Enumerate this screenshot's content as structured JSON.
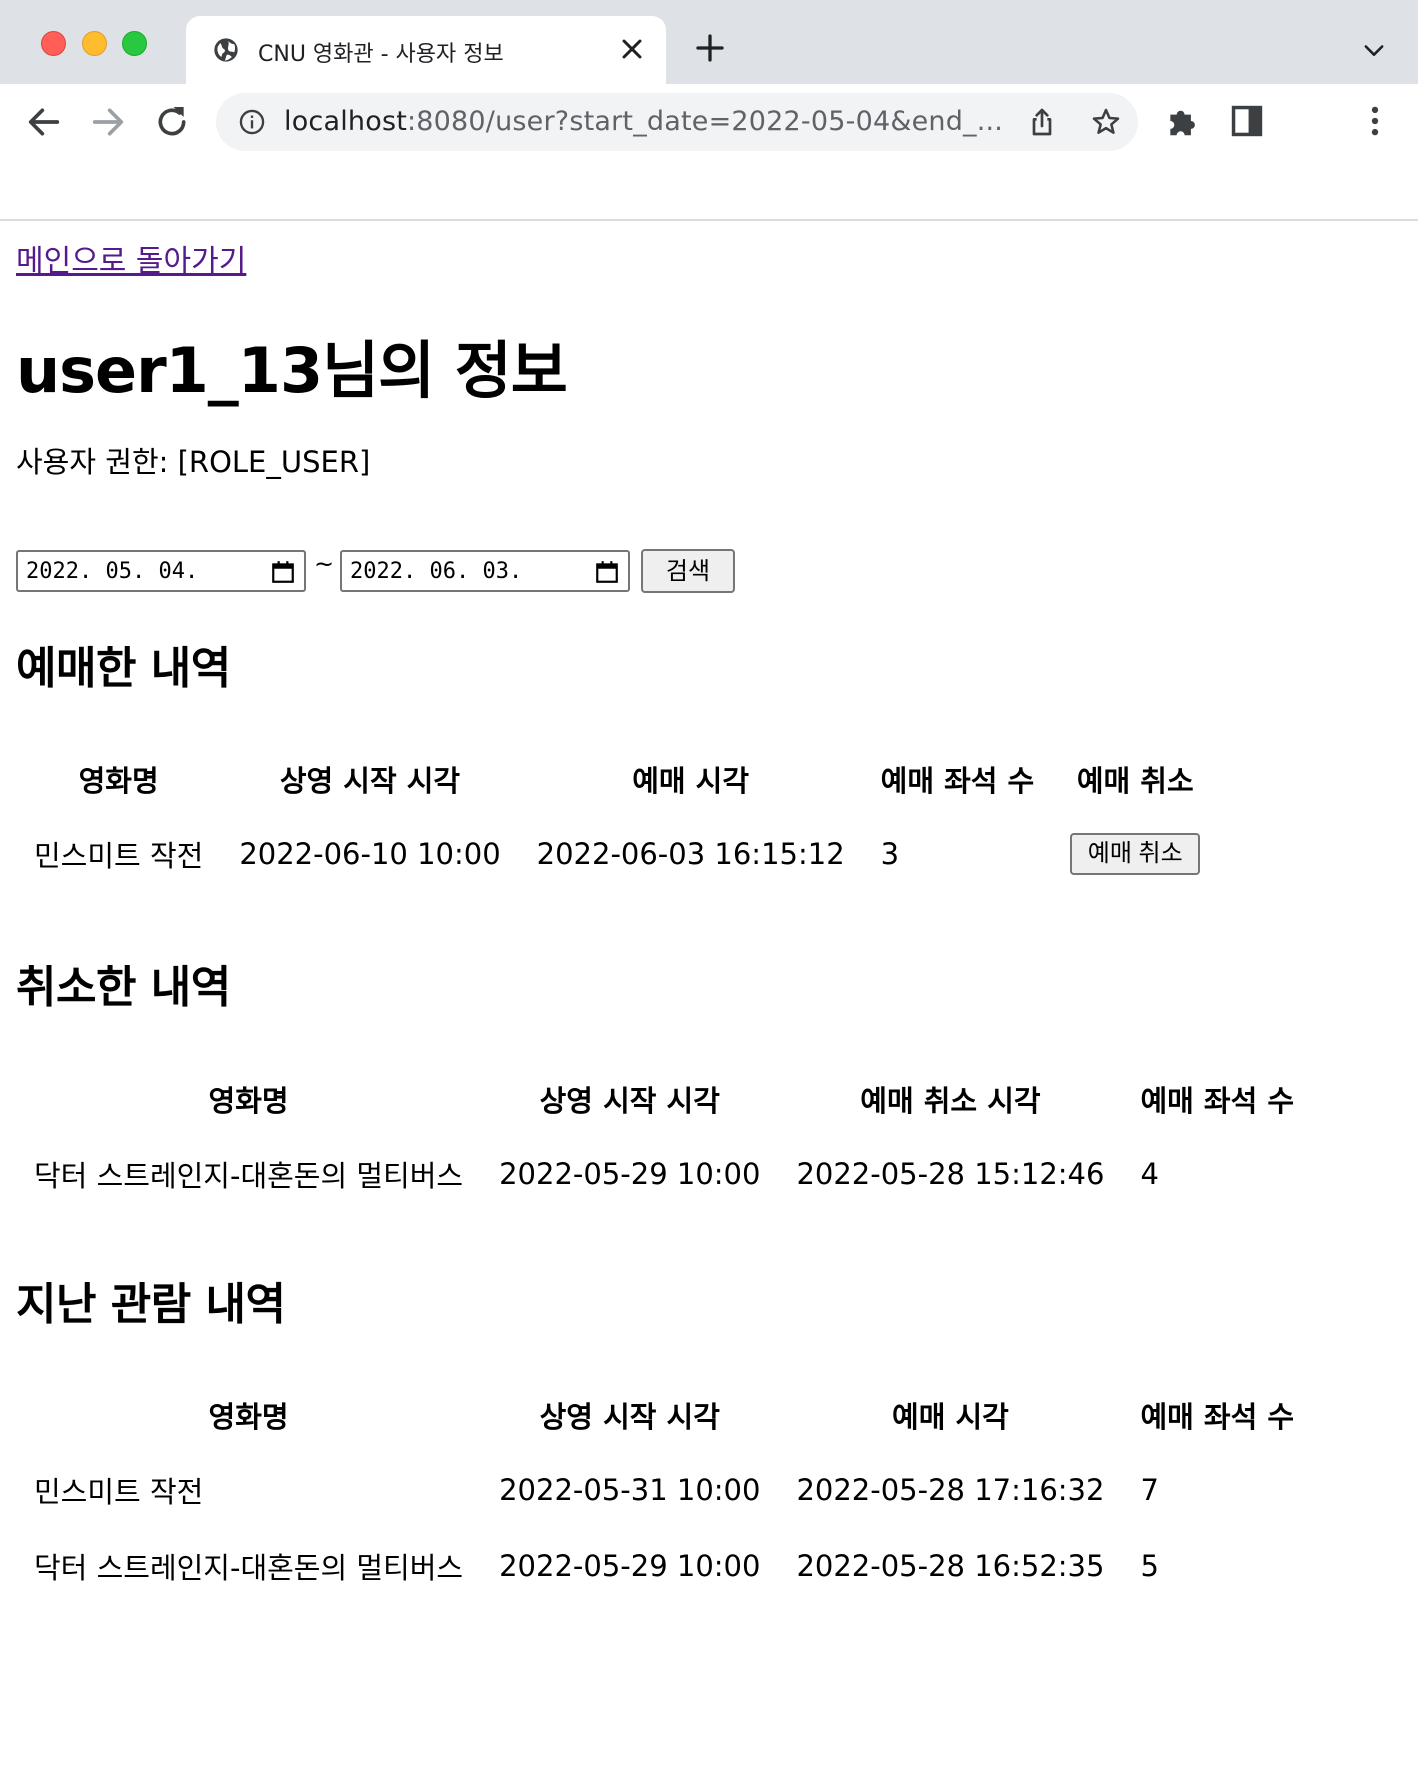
{
  "browser": {
    "tab_title": "CNU 영화관 - 사용자 정보",
    "url_host": "localhost",
    "url_rest": ":8080/user?start_date=2022-05-04&end_...",
    "icons": [
      "globe-icon",
      "close-icon",
      "plus-icon",
      "chevron-down-icon",
      "back-arrow-icon",
      "forward-arrow-icon",
      "reload-icon",
      "info-icon",
      "share-icon",
      "star-icon",
      "puzzle-icon",
      "side-panel-icon",
      "kebab-menu-icon"
    ]
  },
  "page": {
    "back_link": "메인으로 돌아가기",
    "title": "user1_13님의 정보",
    "role_text": "사용자 권한: [ROLE_USER]",
    "filter": {
      "start_date": "2022. 05. 04.",
      "separator": "~",
      "end_date": "2022. 06. 03.",
      "search_label": "검색"
    },
    "reservations": {
      "title": "예매한 내역",
      "headers": [
        "영화명",
        "상영 시작 시각",
        "예매 시각",
        "예매 좌석 수",
        "예매 취소"
      ],
      "rows": [
        {
          "movie": "민스미트 작전",
          "start": "2022-06-10 10:00",
          "reserved_at": "2022-06-03 16:15:12",
          "seats": "3",
          "cancel_label": "예매 취소"
        }
      ]
    },
    "cancellations": {
      "title": "취소한 내역",
      "headers": [
        "영화명",
        "상영 시작 시각",
        "예매 취소 시각",
        "예매 좌석 수"
      ],
      "rows": [
        {
          "movie": "닥터 스트레인지-대혼돈의 멀티버스",
          "start": "2022-05-29 10:00",
          "canceled_at": "2022-05-28 15:12:46",
          "seats": "4"
        }
      ]
    },
    "history": {
      "title": "지난 관람 내역",
      "headers": [
        "영화명",
        "상영 시작 시각",
        "예매 시각",
        "예매 좌석 수"
      ],
      "rows": [
        {
          "movie": "민스미트 작전",
          "start": "2022-05-31 10:00",
          "reserved_at": "2022-05-28 17:16:32",
          "seats": "7"
        },
        {
          "movie": "닥터 스트레인지-대혼돈의 멀티버스",
          "start": "2022-05-29 10:00",
          "reserved_at": "2022-05-28 16:52:35",
          "seats": "5"
        }
      ]
    }
  },
  "colors": {
    "link": "#551a8b",
    "tabstrip": "#dee1e6",
    "button_bg": "#efefef"
  }
}
